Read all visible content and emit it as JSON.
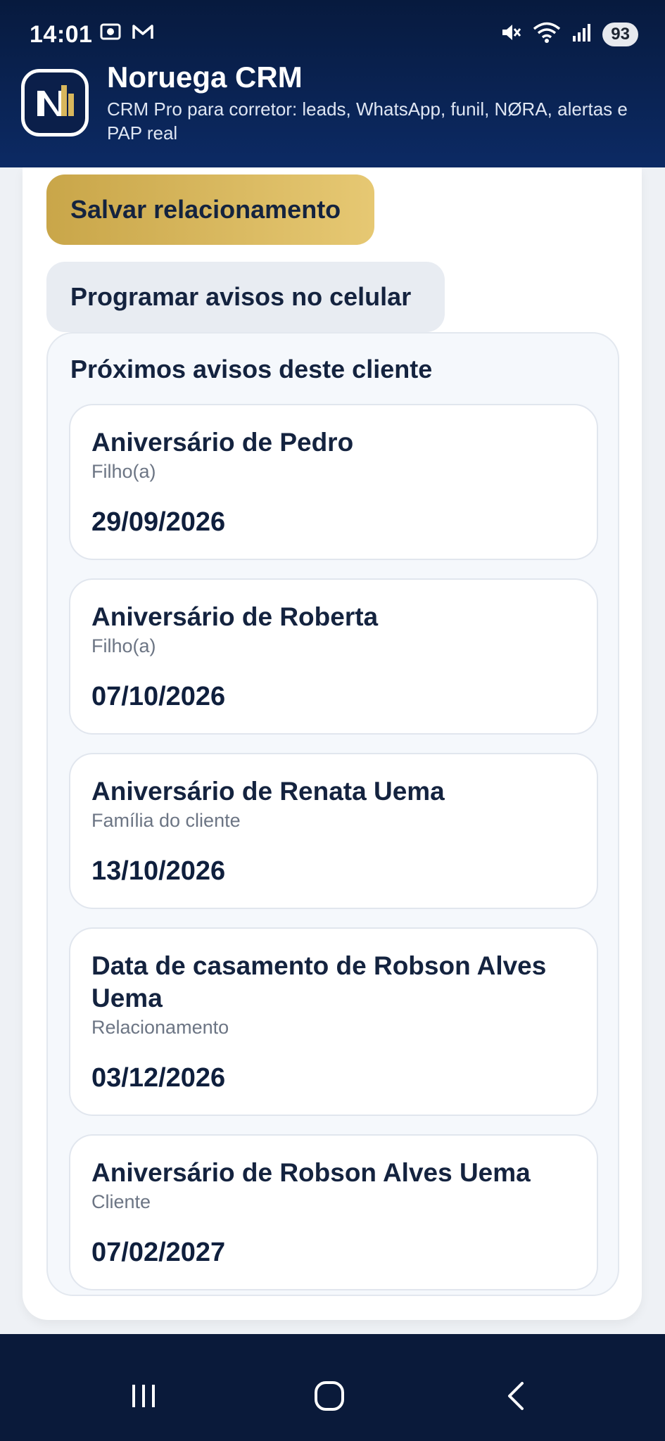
{
  "status_bar": {
    "time": "14:01",
    "battery": "93",
    "icons_left": [
      "screen-record-icon",
      "gmail-icon"
    ],
    "icons_right": [
      "mute-icon",
      "wifi-icon",
      "signal-icon",
      "battery-icon"
    ]
  },
  "header": {
    "title": "Noruega CRM",
    "subtitle": "CRM Pro para corretor: leads, WhatsApp, funil, NØRA, alertas e PAP real"
  },
  "actions": {
    "save_label": "Salvar relacionamento",
    "schedule_label": "Programar avisos no celular"
  },
  "reminders": {
    "title": "Próximos avisos deste cliente",
    "items": [
      {
        "title": "Aniversário de Pedro",
        "subtitle": "Filho(a)",
        "date": "29/09/2026"
      },
      {
        "title": "Aniversário de Roberta",
        "subtitle": "Filho(a)",
        "date": "07/10/2026"
      },
      {
        "title": "Aniversário de Renata Uema",
        "subtitle": "Família do cliente",
        "date": "13/10/2026"
      },
      {
        "title": "Data de casamento de Robson Alves Uema",
        "subtitle": "Relacionamento",
        "date": "03/12/2026"
      },
      {
        "title": "Aniversário de Robson Alves Uema",
        "subtitle": "Cliente",
        "date": "07/02/2027"
      }
    ]
  },
  "colors": {
    "header_bg": "#0c2a64",
    "accent_gold": "#d9b75c",
    "nav_bg": "#0a1a3a"
  }
}
